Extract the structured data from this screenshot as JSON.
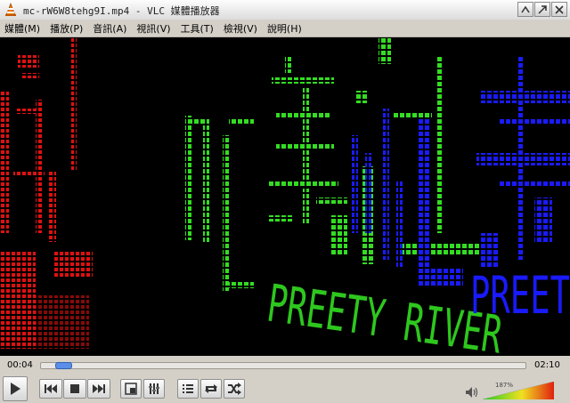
{
  "window": {
    "title": "mc-rW6W8tehg9I.mp4 - VLC 媒體播放器"
  },
  "menu": [
    {
      "label": "媒體(M)",
      "name": "menu-media"
    },
    {
      "label": "播放(P)",
      "name": "menu-playback"
    },
    {
      "label": "音訊(A)",
      "name": "menu-audio"
    },
    {
      "label": "視訊(V)",
      "name": "menu-video"
    },
    {
      "label": "工具(T)",
      "name": "menu-tools"
    },
    {
      "label": "檢視(V)",
      "name": "menu-view"
    },
    {
      "label": "說明(H)",
      "name": "menu-help"
    }
  ],
  "video": {
    "red_text": "美",
    "green_chars": [
      "MC",
      "美",
      "江"
    ],
    "blue_chars": [
      "美",
      "美"
    ],
    "green_caption": "PREETY RIVER",
    "blue_caption": "PREET"
  },
  "player": {
    "elapsed": "00:04",
    "total": "02:10",
    "progress_fraction": 0.03,
    "volume_label": "187%",
    "volume_fraction": 1.0
  },
  "controls": {
    "play": "play-icon",
    "prev": "previous-icon",
    "stop": "stop-icon",
    "next": "next-icon",
    "fullscreen": "fullscreen-icon",
    "extended": "extended-settings-icon",
    "playlist": "playlist-icon",
    "loop": "loop-icon",
    "random": "shuffle-icon"
  },
  "colors": {
    "led_green": "#33dd22",
    "led_blue": "#1a1aff",
    "led_red": "#e01010"
  }
}
